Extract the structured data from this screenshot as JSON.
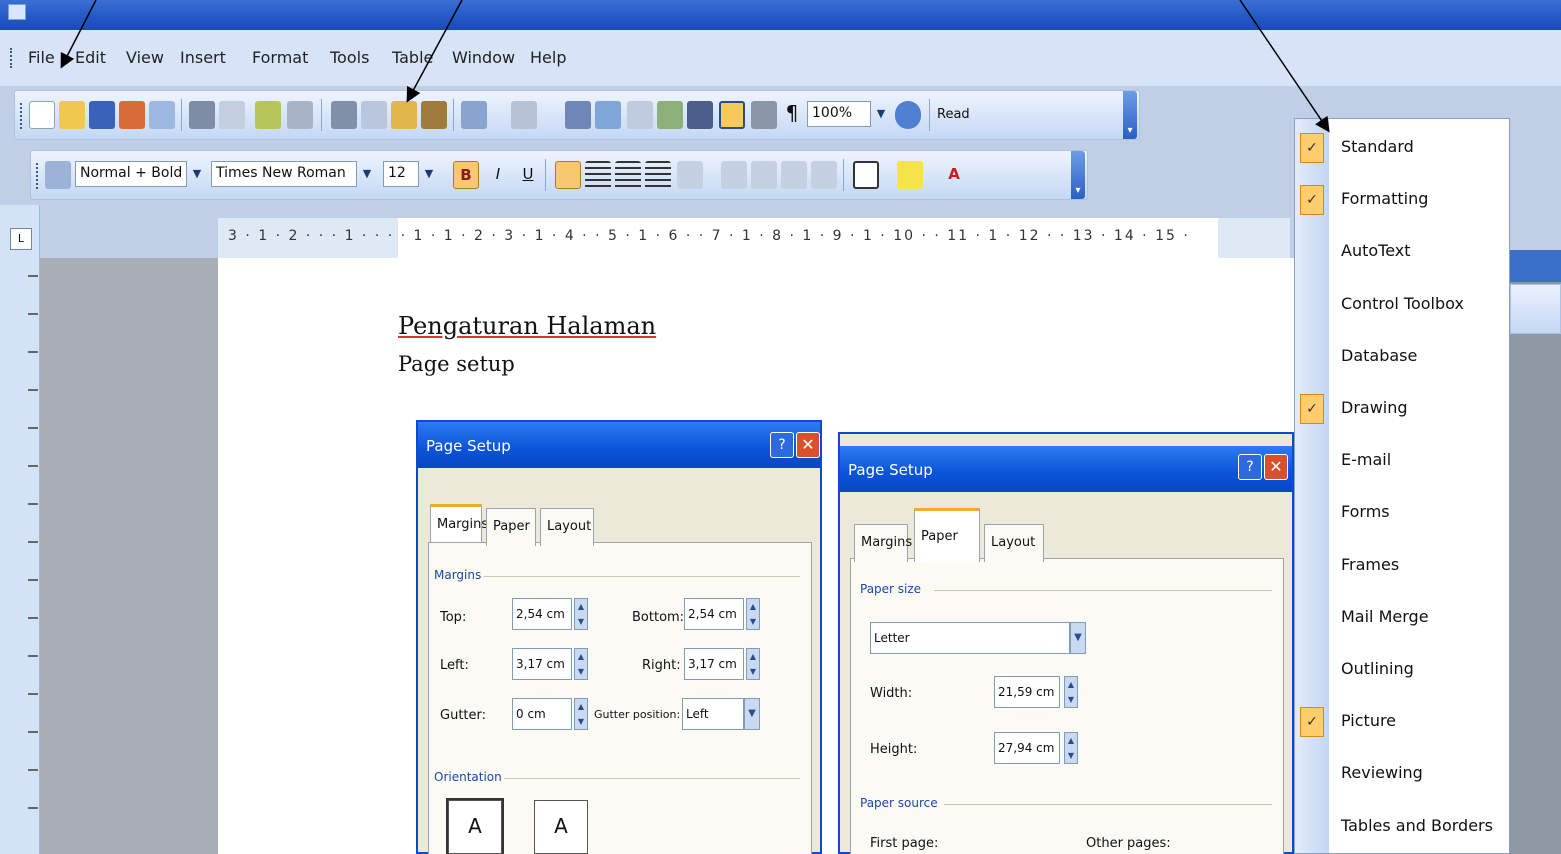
{
  "menubar": {
    "items": [
      "File",
      "Edit",
      "View",
      "Insert",
      "Format",
      "Tools",
      "Table",
      "Window",
      "Help"
    ]
  },
  "standard_toolbar": {
    "zoom": "100%",
    "read_label": "Read"
  },
  "format_toolbar": {
    "style": "Normal + Bold",
    "font": "Times New Roman",
    "size": "12"
  },
  "ruler": {
    "text": "3 · 1 · 2 · · · 1 · · ·    · 1 · 1 · 2 ·   3 · 1 · 4 · · 5 · 1 · 6 · · 7 · 1 · 8 · 1 · 9 · 1 · 10 · · 11 · 1 · 12 · · 13 ·   14 · 15 ·"
  },
  "document": {
    "title": "Pengaturan Halaman",
    "subtitle": "Page setup"
  },
  "dialog1": {
    "title": "Page Setup",
    "tabs": [
      "Margins",
      "Paper",
      "Layout"
    ],
    "group_margins": "Margins",
    "top_label": "Top:",
    "top_value": "2,54 cm",
    "bottom_label": "Bottom:",
    "bottom_value": "2,54 cm",
    "left_label": "Left:",
    "left_value": "3,17 cm",
    "right_label": "Right:",
    "right_value": "3,17 cm",
    "gutter_label": "Gutter:",
    "gutter_value": "0 cm",
    "gutter_pos_label": "Gutter position:",
    "gutter_pos_value": "Left",
    "group_orientation": "Orientation",
    "portrait_glyph": "A",
    "landscape_glyph": "A"
  },
  "dialog2": {
    "title": "Page Setup",
    "tabs": [
      "Margins",
      "Paper",
      "Layout"
    ],
    "group_paper_size": "Paper size",
    "paper_value": "Letter",
    "width_label": "Width:",
    "width_value": "21,59 cm",
    "height_label": "Height:",
    "height_value": "27,94 cm",
    "group_paper_source": "Paper source",
    "first_page_label": "First page:",
    "other_pages_label": "Other pages:"
  },
  "toolbar_menu": {
    "items": [
      {
        "label": "Standard",
        "checked": true
      },
      {
        "label": "Formatting",
        "checked": true
      },
      {
        "label": "AutoText",
        "checked": false
      },
      {
        "label": "Control Toolbox",
        "checked": false
      },
      {
        "label": "Database",
        "checked": false
      },
      {
        "label": "Drawing",
        "checked": true
      },
      {
        "label": "E-mail",
        "checked": false
      },
      {
        "label": "Forms",
        "checked": false
      },
      {
        "label": "Frames",
        "checked": false
      },
      {
        "label": "Mail Merge",
        "checked": false
      },
      {
        "label": "Outlining",
        "checked": false
      },
      {
        "label": "Picture",
        "checked": true
      },
      {
        "label": "Reviewing",
        "checked": false
      },
      {
        "label": "Tables and Borders",
        "checked": false
      }
    ]
  },
  "colors": {
    "title_bar": "#2258c6",
    "toolbar": "#c4d8f3",
    "dialog_title": "#0a53d9",
    "check_highlight": "#ffcd6b"
  }
}
